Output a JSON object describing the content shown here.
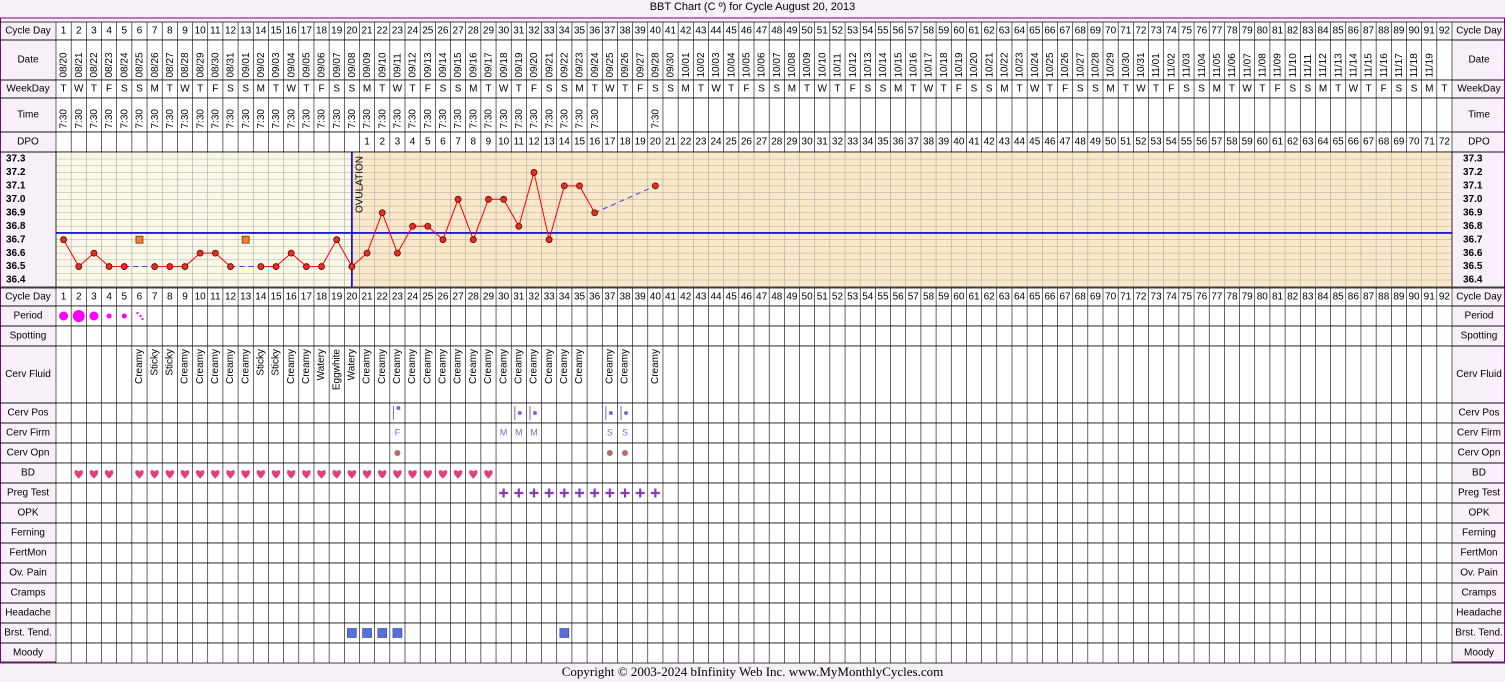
{
  "title": "BBT Chart (C º) for Cycle August 20, 2013",
  "copyright": "Copyright © 2003-2024 bInfinity Web Inc.     www.MyMonthlyCycles.com",
  "colors": {
    "frame": "#800080",
    "grid": "#aaaaaa",
    "pre_ovulation_bg": "#fcf8e8",
    "post_ovulation_bg": "#fbe8c8",
    "temperature_line": "#ff0000",
    "temperature_point": "#e03020",
    "coverline": "#0000cc",
    "ovulation_line": "#0000cc",
    "projection_line": "#4040e0",
    "period": "#ff00ff",
    "bd_heart": "#e0407a",
    "preg_test": "#8040b0",
    "cervix": "#9060c0",
    "cervix_opening": "#b07070",
    "breast_tenderness": "#5870d8"
  },
  "row_labels": {
    "cycle_day": "Cycle Day",
    "date": "Date",
    "weekday": "WeekDay",
    "time": "Time",
    "dpo": "DPO",
    "period": "Period",
    "spotting": "Spotting",
    "cerv_fluid": "Cerv Fluid",
    "cerv_pos": "Cerv Pos",
    "cerv_firm": "Cerv Firm",
    "cerv_opn": "Cerv Opn",
    "bd": "BD",
    "preg_test": "Preg Test",
    "opk": "OPK",
    "ferning": "Ferning",
    "fertmon": "FertMon",
    "ov_pain": "Ov. Pain",
    "cramps": "Cramps",
    "headache": "Headache",
    "brst_tend": "Brst. Tend.",
    "moody": "Moody"
  },
  "ovulation_label": "OVULATION",
  "chart_data": {
    "type": "line",
    "title": "BBT Chart (C º) for Cycle August 20, 2013",
    "y_unit": "C",
    "ylim": [
      36.4,
      37.3
    ],
    "y_ticks": [
      "37.3",
      "37.2",
      "37.1",
      "37.0",
      "36.9",
      "36.8",
      "36.7",
      "36.6",
      "36.5",
      "36.4"
    ],
    "grid": true,
    "cycle_days": 92,
    "dates": [
      "08/20",
      "08/21",
      "08/22",
      "08/23",
      "08/24",
      "08/25",
      "08/26",
      "08/27",
      "08/28",
      "08/29",
      "08/30",
      "08/31",
      "09/01",
      "09/02",
      "09/03",
      "09/04",
      "09/05",
      "09/06",
      "09/07",
      "09/08",
      "09/09",
      "09/10",
      "09/11",
      "09/12",
      "09/13",
      "09/14",
      "09/15",
      "09/16",
      "09/17",
      "09/18",
      "09/19",
      "09/20",
      "09/21",
      "09/22",
      "09/23",
      "09/24",
      "09/25",
      "09/26",
      "09/27",
      "09/28",
      "09/30",
      "10/01",
      "10/02",
      "10/03",
      "10/04",
      "10/05",
      "10/06",
      "10/07",
      "10/08",
      "10/09",
      "10/10",
      "10/11",
      "10/12",
      "10/13",
      "10/14",
      "10/15",
      "10/16",
      "10/17",
      "10/18",
      "10/19",
      "10/20",
      "10/21",
      "10/22",
      "10/23",
      "10/24",
      "10/25",
      "10/26",
      "10/27",
      "10/28",
      "10/29",
      "10/30",
      "10/31",
      "11/01",
      "11/02",
      "11/03",
      "11/04",
      "11/05",
      "11/06",
      "11/07",
      "11/08",
      "11/09",
      "11/10",
      "11/11",
      "11/12",
      "11/13",
      "11/14",
      "11/15",
      "11/16",
      "11/17",
      "11/18",
      "11/19"
    ],
    "weekdays": [
      "T",
      "W",
      "T",
      "F",
      "S",
      "S",
      "M",
      "T",
      "W",
      "T",
      "F",
      "S",
      "S",
      "M",
      "T",
      "W",
      "T",
      "F",
      "S",
      "S",
      "M",
      "T",
      "W",
      "T",
      "F",
      "S",
      "S",
      "M",
      "T",
      "W",
      "T",
      "F",
      "S",
      "S",
      "M",
      "T",
      "W",
      "T",
      "F",
      "S",
      "S",
      "M",
      "T",
      "W",
      "T",
      "F",
      "S",
      "S",
      "M",
      "T",
      "W",
      "T",
      "F",
      "S",
      "S",
      "M",
      "T",
      "W",
      "T",
      "F",
      "S",
      "S",
      "M",
      "T",
      "W",
      "T",
      "F",
      "S",
      "S",
      "M",
      "T",
      "W",
      "T",
      "F",
      "S",
      "S",
      "M",
      "T",
      "W",
      "T",
      "F",
      "S",
      "S",
      "M",
      "T",
      "W",
      "T",
      "F",
      "S",
      "S",
      "M",
      "T"
    ],
    "times": [
      "7:30",
      "7:30",
      "7:30",
      "7:30",
      "7:30",
      "7:30",
      "7:30",
      "7:30",
      "7:30",
      "7:30",
      "7:30",
      "7:30",
      "7:30",
      "7:30",
      "7:30",
      "7:30",
      "7:30",
      "7:30",
      "7:30",
      "7:30",
      "7:30",
      "7:30",
      "7:30",
      "7:30",
      "7:30",
      "7:30",
      "7:30",
      "7:30",
      "7:30",
      "7:30",
      "7:30",
      "7:30",
      "7:30",
      "7:30",
      "7:30",
      "7:30",
      "",
      "",
      "",
      "7:30"
    ],
    "dpo_start_day": 21,
    "dpo_count": 72,
    "ovulation_day": 20,
    "coverline": 36.75,
    "temperatures": [
      36.7,
      36.5,
      36.6,
      36.5,
      36.5,
      null,
      36.5,
      36.5,
      36.5,
      36.6,
      36.6,
      36.5,
      null,
      36.5,
      36.5,
      36.6,
      36.5,
      36.5,
      36.7,
      36.5,
      36.6,
      36.9,
      36.6,
      36.8,
      36.8,
      36.7,
      37.0,
      36.7,
      37.0,
      37.0,
      36.8,
      37.2,
      36.7,
      37.1,
      37.1,
      36.9,
      null,
      null,
      null,
      37.1
    ],
    "open_markers": [
      {
        "day": 6,
        "temp": 36.7
      },
      {
        "day": 13,
        "temp": 36.7
      }
    ],
    "period": [
      {
        "day": 1,
        "level": "medium"
      },
      {
        "day": 2,
        "level": "heavy"
      },
      {
        "day": 3,
        "level": "medium"
      },
      {
        "day": 4,
        "level": "light"
      },
      {
        "day": 5,
        "level": "light"
      },
      {
        "day": 6,
        "level": "spotting"
      }
    ],
    "cerv_fluid": {
      "6": "Creamy",
      "7": "Sticky",
      "8": "Sticky",
      "9": "Creamy",
      "10": "Creamy",
      "11": "Creamy",
      "12": "Creamy",
      "13": "Creamy",
      "14": "Sticky",
      "15": "Sticky",
      "16": "Creamy",
      "17": "Creamy",
      "18": "Watery",
      "19": "Eggwhite",
      "20": "Watery",
      "21": "Creamy",
      "22": "Creamy",
      "23": "Creamy",
      "24": "Creamy",
      "25": "Creamy",
      "26": "Creamy",
      "27": "Creamy",
      "28": "Creamy",
      "29": "Creamy",
      "30": "Creamy",
      "31": "Creamy",
      "32": "Creamy",
      "33": "Creamy",
      "34": "Creamy",
      "35": "Creamy",
      "37": "Creamy",
      "38": "Creamy",
      "40": "Creamy"
    },
    "cerv_pos": [
      {
        "day": 23,
        "pos": "high"
      },
      {
        "day": 31,
        "pos": "mid"
      },
      {
        "day": 32,
        "pos": "mid"
      },
      {
        "day": 37,
        "pos": "mid"
      },
      {
        "day": 38,
        "pos": "mid"
      }
    ],
    "cerv_firm": {
      "23": "F",
      "30": "M",
      "31": "M",
      "32": "M",
      "37": "S",
      "38": "S"
    },
    "cerv_opn_days": [
      23,
      37,
      38
    ],
    "bd_days": [
      2,
      3,
      4,
      6,
      7,
      8,
      9,
      10,
      11,
      12,
      13,
      14,
      15,
      16,
      17,
      18,
      19,
      20,
      21,
      22,
      23,
      24,
      25,
      26,
      27,
      28,
      29
    ],
    "preg_test_days": [
      30,
      31,
      32,
      33,
      34,
      35,
      36,
      37,
      38,
      39,
      40
    ],
    "brst_tend_days": [
      20,
      21,
      22,
      23,
      34
    ]
  }
}
